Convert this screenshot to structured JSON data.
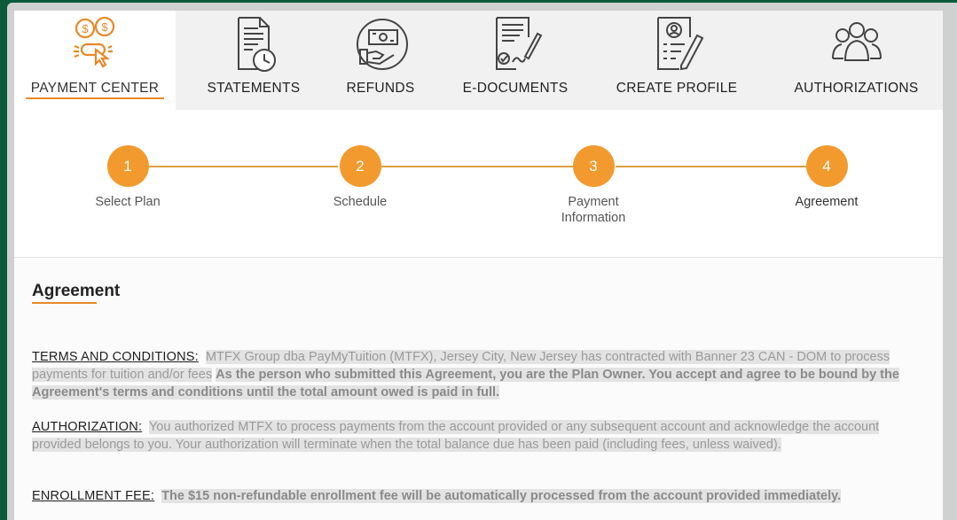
{
  "tabs": [
    {
      "label": "PAYMENT CENTER",
      "icon": "payment-click-icon",
      "active": true
    },
    {
      "label": "STATEMENTS",
      "icon": "statement-clock-icon",
      "active": false
    },
    {
      "label": "REFUNDS",
      "icon": "refund-hand-icon",
      "active": false
    },
    {
      "label": "E-DOCUMENTS",
      "icon": "document-sign-icon",
      "active": false
    },
    {
      "label": "CREATE PROFILE",
      "icon": "profile-pencil-icon",
      "active": false
    },
    {
      "label": "AUTHORIZATIONS",
      "icon": "users-group-icon",
      "active": false
    }
  ],
  "steps": [
    {
      "number": "1",
      "label": "Select Plan"
    },
    {
      "number": "2",
      "label": "Schedule"
    },
    {
      "number": "3",
      "label": "Payment Information"
    },
    {
      "number": "4",
      "label": "Agreement",
      "current": true
    }
  ],
  "agreement": {
    "title": "Agreement",
    "terms": {
      "heading": "TERMS AND CONDITIONS:",
      "text": "MTFX Group dba PayMyTuition (MTFX), Jersey City, New Jersey has contracted with Banner 23 CAN - DOM to process payments for tuition and/or fees",
      "bold": "As the person who submitted this Agreement, you are the Plan Owner. You accept and agree to be bound by the Agreement's terms and conditions until the total amount owed is paid in full."
    },
    "authorization": {
      "heading": "AUTHORIZATION:",
      "text": "You authorized MTFX to process payments from the account provided or any subsequent account and acknowledge the account provided belongs to you. Your authorization will terminate when the total balance due has been paid (including fees, unless waived)."
    },
    "enrollment": {
      "heading": "ENROLLMENT FEE:",
      "bold": "The $15 non-refundable enrollment fee will be automatically processed from the account provided immediately."
    }
  },
  "colors": {
    "accent": "#f29a2e",
    "underline": "#e8892a",
    "background": "#0b5a3c"
  }
}
